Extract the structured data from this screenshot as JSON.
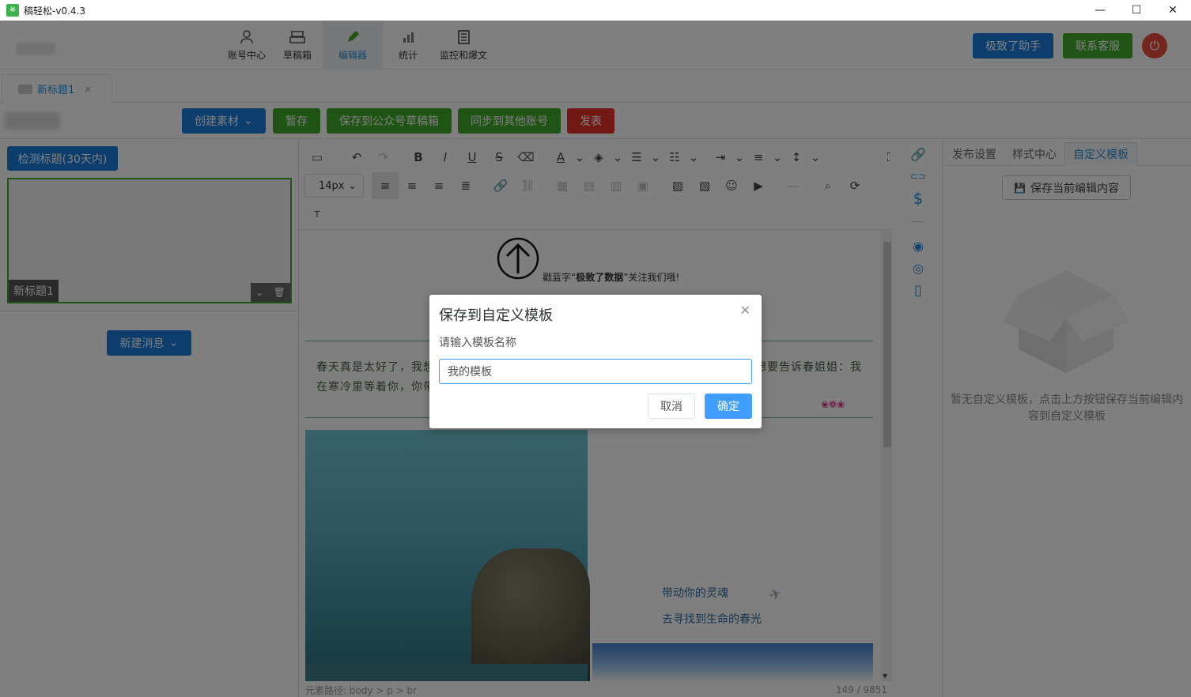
{
  "window": {
    "title": "稿轻松-v0.4.3",
    "logo_glyph": "※",
    "minimize": "—",
    "maximize": "☐",
    "close": "✕"
  },
  "nav": {
    "items": [
      {
        "label": "账号中心",
        "icon": "user-icon"
      },
      {
        "label": "草稿箱",
        "icon": "inbox-icon"
      },
      {
        "label": "编辑器",
        "icon": "pencil-icon",
        "active": true
      },
      {
        "label": "统计",
        "icon": "bar-chart-icon"
      },
      {
        "label": "监控和爆文",
        "icon": "document-icon"
      }
    ],
    "assistant_label": "极致了助手",
    "support_label": "联系客服",
    "power_glyph": "⏻"
  },
  "tabs": {
    "current_title": "新标题1",
    "close_glyph": "×"
  },
  "actions": {
    "create_material": "创建素材",
    "temp_save": "暂存",
    "save_to_draft": "保存到公众号草稿箱",
    "sync_accounts": "同步到其他账号",
    "publish": "发表",
    "dropdown_glyph": "⌄"
  },
  "left": {
    "detect_label": "检测标题(30天内)",
    "card_title": "新标题1",
    "new_message_label": "新建消息",
    "card_expand_glyph": "⌄",
    "card_delete_glyph": "🗑",
    "dropdown_glyph": "⌄"
  },
  "toolbar": {
    "font_size": "14px",
    "font_size_caret": "⌄",
    "row1_glyphs": {
      "source": "▭",
      "undo": "↶",
      "redo": "↷",
      "bold": "B",
      "italic": "I",
      "underline": "U",
      "strike": "S",
      "eraser": "⌫",
      "font_color": "A",
      "highlight": "◈",
      "ordered_list": "☰",
      "unordered_list": "☷",
      "indent": "⇥",
      "align_text": "≡",
      "line_height": "↕",
      "fullscreen": "⛶",
      "caret": "⌄"
    },
    "row2_glyphs": {
      "align_left": "≡",
      "align_center": "≡",
      "align_right": "≡",
      "align_justify": "≣",
      "link": "🔗",
      "unlink": "⛓",
      "table": "▦",
      "table_row": "▤",
      "table_col": "▥",
      "table_merge": "▣",
      "image_block": "▨",
      "image": "▧",
      "emoji": "☺",
      "video": "▶",
      "hr": "—",
      "find": "⌕",
      "replace": "⟳"
    },
    "row3_glyphs": {
      "text_box": "T"
    }
  },
  "content": {
    "follow_prefix": "戳蓝字“",
    "follow_name": "极致了数据",
    "follow_suffix": "”关注我们哦!",
    "paragraph": "春天真是太好了，我想要告诉春姐姐：我在寒冷的冬天里等着你匆匆忙忙地赶来。我想要告诉春姐姐：我在寒冷里等着你，你带来了新的喜悦。",
    "flowers_glyph": "❀❁❀",
    "plane_glyph": "✈",
    "lyric1": "带动你的灵魂",
    "lyric2": "去寻找到生命的春光",
    "scroll_down_glyph": "▼"
  },
  "status": {
    "path": "元素路径: body > p > br",
    "count": "149 / 9851"
  },
  "side_icons": {
    "link": "🔗",
    "chain": "⊂⊃",
    "dollar": "$",
    "eye": "◉",
    "scan": "◎",
    "mobile": "▯"
  },
  "right": {
    "tabs": [
      "发布设置",
      "样式中心",
      "自定义模板"
    ],
    "save_current_label": "保存当前编辑内容",
    "save_glyph": "💾",
    "empty_text": "暂无自定义模板，点击上方按钮保存当前编辑内容到自定义模板"
  },
  "modal": {
    "title": "保存到自定义模板",
    "label": "请输入模板名称",
    "input_value": "我的模板",
    "cancel": "取消",
    "confirm": "确定",
    "close_glyph": "✕"
  },
  "colors": {
    "accent_blue": "#1b7ad8",
    "accent_green": "#3fa92a",
    "danger_red": "#e5312b",
    "primary": "#409eff"
  }
}
